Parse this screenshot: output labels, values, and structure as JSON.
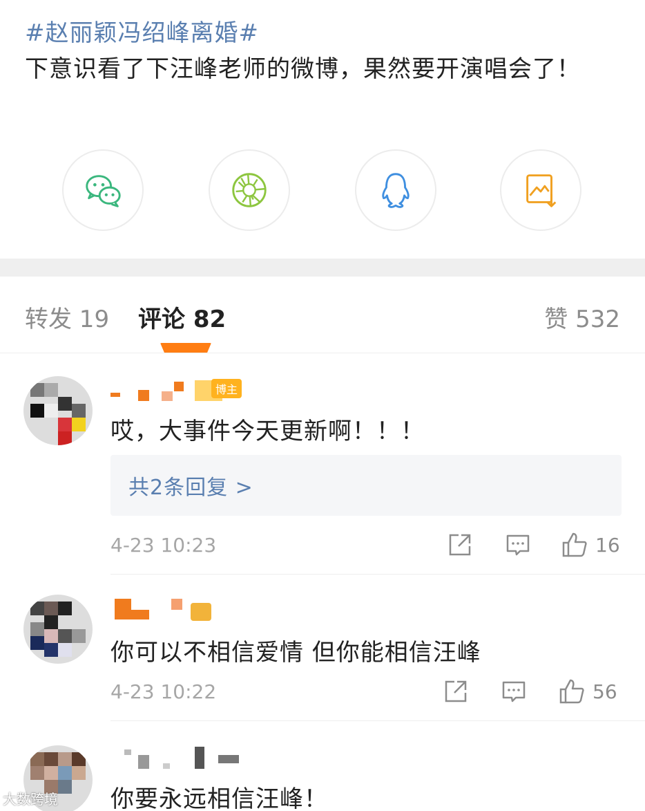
{
  "post": {
    "hashtag": "#赵丽颖冯绍峰离婚#",
    "text": "下意识看了下汪峰老师的微博，果然要开演唱会了！"
  },
  "share": [
    {
      "name": "wechat-icon",
      "color": "#3bb77e"
    },
    {
      "name": "moments-icon",
      "color": "#8dc63f"
    },
    {
      "name": "qq-icon",
      "color": "#3f8fe0"
    },
    {
      "name": "save-image-icon",
      "color": "#f0a020"
    }
  ],
  "tabs": {
    "repost": "转发 19",
    "comments": "评论 82",
    "likes": "赞 532",
    "accent": "#ff7d12"
  },
  "comments": [
    {
      "badge": "博主",
      "text": "哎，大事件今天更新啊！！！",
      "reply_link": "共2条回复 >",
      "time": "4-23 10:23",
      "likes": "16"
    },
    {
      "text": "你可以不相信爱情 但你能相信汪峰",
      "time": "4-23 10:22",
      "likes": "56"
    },
    {
      "text": "你要永远相信汪峰！"
    }
  ],
  "watermark": "大数跨境"
}
